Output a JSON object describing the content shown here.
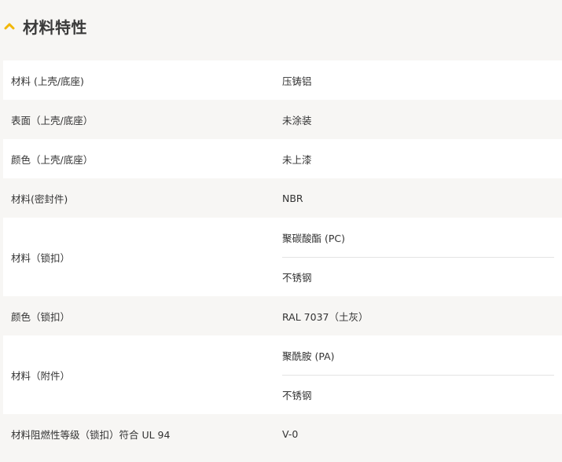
{
  "section": {
    "title": "材料特性",
    "icon": "chevron-up-icon",
    "accent_color": "#f2b705"
  },
  "properties": [
    {
      "label": "材料 (上壳/底座)",
      "values": [
        "压铸铝"
      ]
    },
    {
      "label": "表面（上壳/底座）",
      "values": [
        "未涂装"
      ]
    },
    {
      "label": "颜色（上壳/底座）",
      "values": [
        "未上漆"
      ]
    },
    {
      "label": "材料(密封件)",
      "values": [
        "NBR"
      ]
    },
    {
      "label": "材料（锁扣）",
      "values": [
        "聚碳酸酯 (PC)",
        "不锈钢"
      ]
    },
    {
      "label": "颜色（锁扣）",
      "values": [
        "RAL 7037（土灰）"
      ]
    },
    {
      "label": "材料（附件）",
      "values": [
        "聚酰胺 (PA)",
        "不锈钢"
      ]
    },
    {
      "label": "材料阻燃性等级（锁扣）符合 UL 94",
      "values": [
        "V-0"
      ]
    }
  ]
}
